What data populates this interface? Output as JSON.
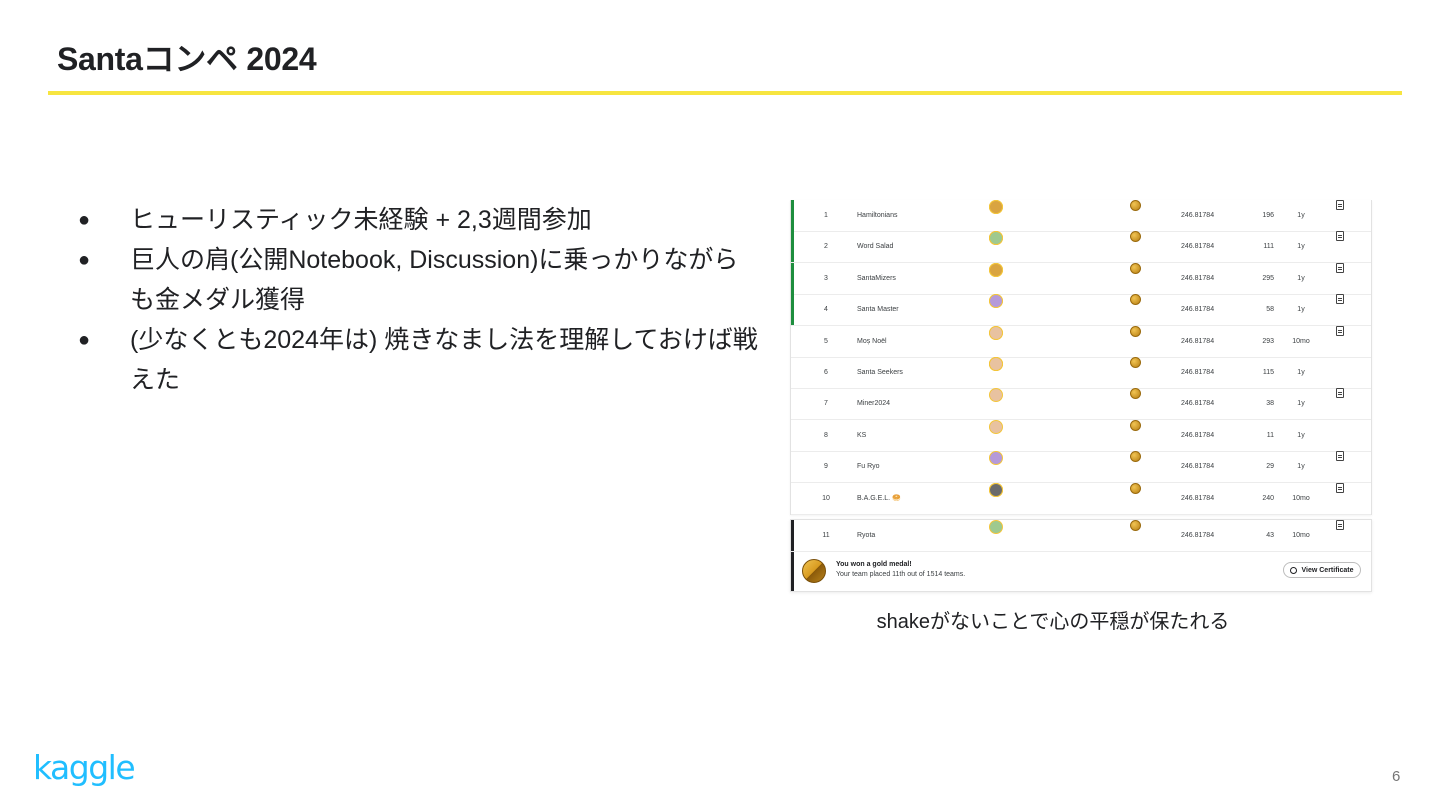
{
  "slide": {
    "title": "Santaコンペ 2024",
    "page_number": "6",
    "logo_text": "kaggle",
    "accent_color": "#f7e540",
    "logo_color": "#20beff"
  },
  "bullets": [
    {
      "marker": "●",
      "text": "ヒューリスティック未経験  + 2,3週間参加"
    },
    {
      "marker": "●",
      "text": "巨人の肩(公開Notebook, Discussion)に乗っかりながらも金メダル獲得"
    },
    {
      "marker": "●",
      "text": "(少なくとも2024年は) 焼きなまし法を理解しておけば戦えた"
    }
  ],
  "leaderboard": {
    "rows": [
      {
        "rank": "1",
        "team": "Hamiltonians",
        "avatars": 3,
        "score": "246.81784",
        "entries": "196",
        "last": "1y",
        "notebook": true,
        "gold": true
      },
      {
        "rank": "2",
        "team": "Word Salad",
        "avatars": 3,
        "score": "246.81784",
        "entries": "111",
        "last": "1y",
        "notebook": true,
        "gold": true
      },
      {
        "rank": "3",
        "team": "SantaMizers",
        "avatars": 4,
        "score": "246.81784",
        "entries": "295",
        "last": "1y",
        "notebook": true,
        "gold": true
      },
      {
        "rank": "4",
        "team": "Santa Master",
        "avatars": 2,
        "score": "246.81784",
        "entries": "58",
        "last": "1y",
        "notebook": true,
        "gold": true
      },
      {
        "rank": "5",
        "team": "Moș Noël",
        "avatars": 2,
        "score": "246.81784",
        "entries": "293",
        "last": "10mo",
        "notebook": true,
        "gold": false
      },
      {
        "rank": "6",
        "team": "Santa Seekers",
        "avatars": 4,
        "score": "246.81784",
        "entries": "115",
        "last": "1y",
        "notebook": false,
        "gold": false
      },
      {
        "rank": "7",
        "team": "Miner2024",
        "avatars": 1,
        "score": "246.81784",
        "entries": "38",
        "last": "1y",
        "notebook": true,
        "gold": false
      },
      {
        "rank": "8",
        "team": "KS",
        "avatars": 1,
        "score": "246.81784",
        "entries": "11",
        "last": "1y",
        "notebook": false,
        "gold": false
      },
      {
        "rank": "9",
        "team": "Fu Ryo",
        "avatars": 1,
        "score": "246.81784",
        "entries": "29",
        "last": "1y",
        "notebook": true,
        "gold": false
      },
      {
        "rank": "10",
        "team": "B.A.G.E.L. 🥯",
        "avatars": 5,
        "score": "246.81784",
        "entries": "240",
        "last": "10mo",
        "notebook": true,
        "gold": false
      }
    ],
    "user_row": {
      "rank": "11",
      "team": "Ryota",
      "avatars": 1,
      "score": "246.81784",
      "entries": "43",
      "last": "10mo",
      "notebook": true
    },
    "gold_title": "You won a gold medal!",
    "gold_subtitle": "Your team placed 11th out of 1514 teams.",
    "certificate_button": "View Certificate"
  },
  "caption": "shakeがないことで心の平穏が保たれる"
}
